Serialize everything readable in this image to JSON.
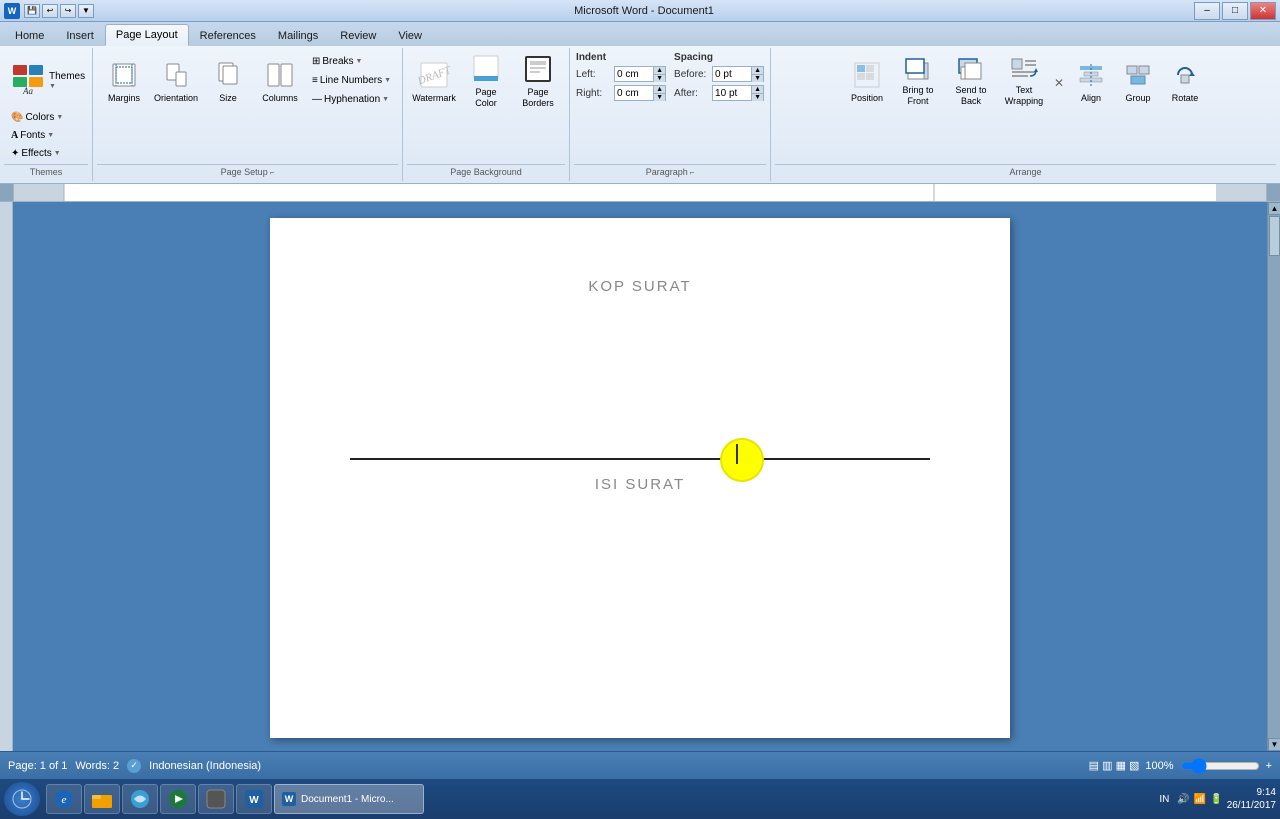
{
  "titlebar": {
    "title": "Microsoft Word - Document1",
    "icon": "W",
    "minimize": "–",
    "maximize": "□",
    "close": "✕"
  },
  "tabs": [
    {
      "label": "Home",
      "active": false
    },
    {
      "label": "Insert",
      "active": false
    },
    {
      "label": "Page Layout",
      "active": true
    },
    {
      "label": "References",
      "active": false
    },
    {
      "label": "Mailings",
      "active": false
    },
    {
      "label": "Review",
      "active": false
    },
    {
      "label": "View",
      "active": false
    }
  ],
  "ribbon": {
    "themes_group": {
      "label": "Themes",
      "buttons": {
        "themes": "Themes",
        "colors": "Colors",
        "fonts": "Fonts",
        "effects": "Effects"
      }
    },
    "page_setup_group": {
      "label": "Page Setup",
      "buttons": {
        "margins": "Margins",
        "orientation": "Orientation",
        "size": "Size",
        "columns": "Columns",
        "breaks": "Breaks",
        "line_numbers": "Line Numbers",
        "hyphenation": "Hyphenation"
      }
    },
    "page_background_group": {
      "label": "Page Background",
      "buttons": {
        "watermark": "Watermark",
        "page_color": "Page Color",
        "page_borders": "Page Borders"
      }
    },
    "paragraph_group": {
      "label": "Paragraph",
      "indent": {
        "title": "Indent",
        "left_label": "Left:",
        "left_value": "0 cm",
        "right_label": "Right:",
        "right_value": "0 cm"
      },
      "spacing": {
        "title": "Spacing",
        "before_label": "Before:",
        "before_value": "0 pt",
        "after_label": "After:",
        "after_value": "10 pt"
      }
    },
    "arrange_group": {
      "label": "Arrange",
      "buttons": {
        "position": "Position",
        "bring_to_front": "Bring to Front",
        "send_to_back": "Send to Back",
        "text_wrapping": "Text Wrapping",
        "align": "Align",
        "group": "Group",
        "rotate": "Rotate"
      }
    }
  },
  "document": {
    "kop_surat": "KOP SURAT",
    "isi_surat": "ISI SURAT"
  },
  "statusbar": {
    "page": "Page: 1 of 1",
    "words": "Words: 2",
    "language": "Indonesian (Indonesia)",
    "zoom": "100%"
  },
  "taskbar": {
    "time": "9:14",
    "date": "26/11/2017",
    "language": "IN"
  }
}
